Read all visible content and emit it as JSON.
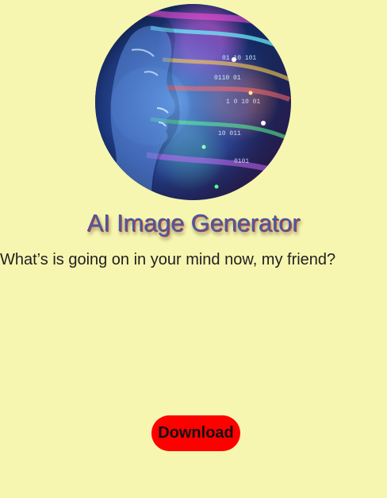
{
  "page": {
    "background_color": "#f7f6b0"
  },
  "hero": {
    "image_name": "ai-face-hero-image",
    "image_description": "Digital human profile with neon data streams"
  },
  "header": {
    "title": "AI Image Generator"
  },
  "prompt": {
    "text": "What’s is going on in your mind now, my friend?"
  },
  "actions": {
    "download_label": "Download",
    "download_color": "#ff0000"
  }
}
